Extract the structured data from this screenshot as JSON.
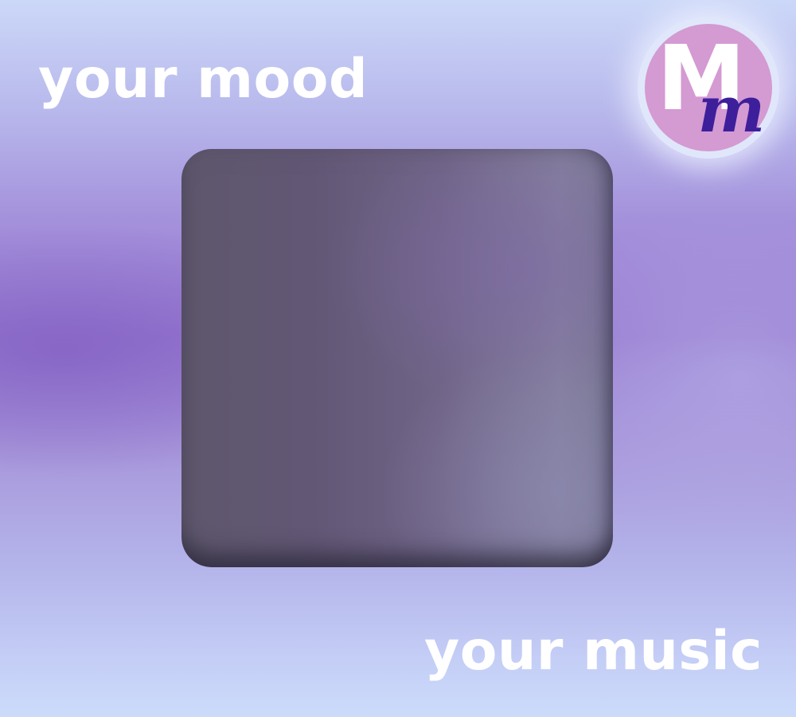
{
  "headline_top": "your mood",
  "headline_bottom": "your music",
  "logo": {
    "letter_upper": "M",
    "letter_lower": "m",
    "icon": "mm-monogram-logo",
    "colors": {
      "ring": "#e0e7fb",
      "fill": "#d49ad2",
      "upper_letter": "#ffffff",
      "lower_letter": "#3d1f9c"
    }
  },
  "artwork": {
    "icon": "album-art-placeholder"
  }
}
